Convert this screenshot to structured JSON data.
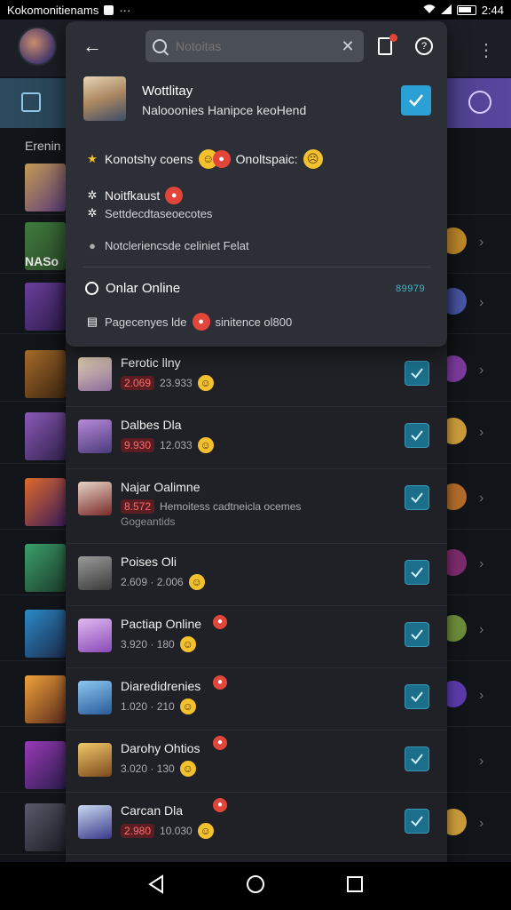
{
  "statusbar": {
    "app_title": "Kokomonitienams",
    "time": "2:44"
  },
  "popup": {
    "search_placeholder": "Notoitas",
    "profile_title": "Wottlitay",
    "profile_subtitle": "Nalooonies Hanipce keoHend",
    "line1_text": "Konotshy coens",
    "line1_text2": "Onoltspaic:",
    "line2_text": "Noitfkaust",
    "line3_text": "Settdecdtaseoecotes",
    "line4_text": "Notcleriencsde celiniet Felat",
    "online_label": "Onlar Online",
    "online_count": "89979",
    "footer_text": "Pagecenyes lde",
    "footer_text2": "sinitence ol800"
  },
  "background": {
    "label1": "Erenin",
    "label2": "NASo"
  },
  "rows": [
    {
      "name": "Ferotic llny",
      "pill": "2.069",
      "value": "23.933",
      "sub": ""
    },
    {
      "name": "Dalbes Dla",
      "pill": "9.930",
      "value": "12.033",
      "sub": ""
    },
    {
      "name": "Najar Oalimne",
      "pill": "8.572",
      "value": "Hemoitess cadtneicla ocemes",
      "sub": "Gogeantids"
    },
    {
      "name": "Poises Oli",
      "pill": "",
      "value": "2.609 · 2.006",
      "sub": ""
    },
    {
      "name": "Pactiap Online",
      "pill": "",
      "value": "3.920 · 180",
      "sub": ""
    },
    {
      "name": "Diaredidrenies",
      "pill": "",
      "value": "1.020 · 210",
      "sub": ""
    },
    {
      "name": "Darohy Ohtios",
      "pill": "",
      "value": "3.020 · 130",
      "sub": ""
    },
    {
      "name": "Carcan Dla",
      "pill": "2.980",
      "value": "10.030",
      "sub": ""
    }
  ],
  "colors": {
    "accent": "#2aa0d4",
    "danger": "#e2463a",
    "online": "#3fb6c9"
  }
}
